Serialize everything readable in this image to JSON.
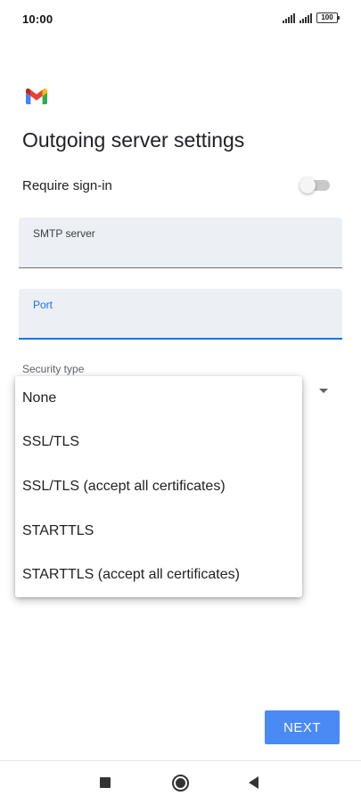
{
  "status_bar": {
    "time": "10:00",
    "battery": "100",
    "icons": [
      "signal-icon",
      "signal-icon",
      "battery-icon"
    ]
  },
  "app": {
    "logo": "gmail-logo",
    "colors": {
      "red": "#EA4335",
      "blue": "#4285F4",
      "green": "#34A853",
      "yellow": "#FBBC04"
    }
  },
  "page": {
    "title": "Outgoing server settings"
  },
  "require_signin": {
    "label": "Require sign-in",
    "enabled": false
  },
  "smtp_server": {
    "label": "SMTP server",
    "value": ""
  },
  "port": {
    "label": "Port",
    "value": "",
    "focused": true
  },
  "security_type": {
    "label": "Security type",
    "options": [
      "None",
      "SSL/TLS",
      "SSL/TLS (accept all certificates)",
      "STARTTLS",
      "STARTTLS (accept all certificates)"
    ]
  },
  "actions": {
    "next_label": "NEXT",
    "accent_color": "#4A8AF4"
  },
  "nav_bar": {
    "icons": [
      "recents-square-icon",
      "home-circle-icon",
      "back-triangle-icon"
    ]
  }
}
